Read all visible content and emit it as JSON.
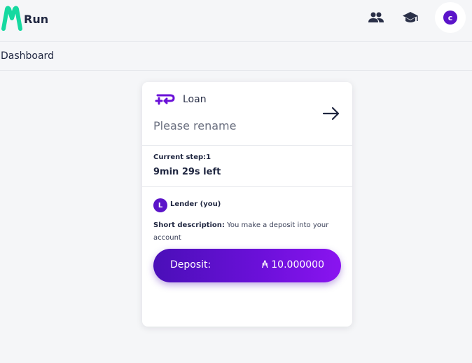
{
  "app": {
    "logo_text": "Run"
  },
  "header": {
    "icons": [
      "people-icon",
      "graduation-cap-icon"
    ],
    "avatar_initial": "c"
  },
  "breadcrumb": {
    "label": "Dashboard"
  },
  "card": {
    "type_label": "Loan",
    "name_placeholder": "Please rename",
    "current_step_label": "Current step:1",
    "time_left": "9min 29s left",
    "role_initial": "L",
    "role_label": "Lender (you)",
    "short_description_label": "Short description:",
    "short_description_text": " You make a deposit into your account",
    "deposit_label": "Deposit:",
    "deposit_value": "₳ 10.000000"
  },
  "colors": {
    "accent": "#5b14c9",
    "logo_green": "#16d9a0",
    "text": "#1f2640",
    "background": "#f5f6f8"
  }
}
